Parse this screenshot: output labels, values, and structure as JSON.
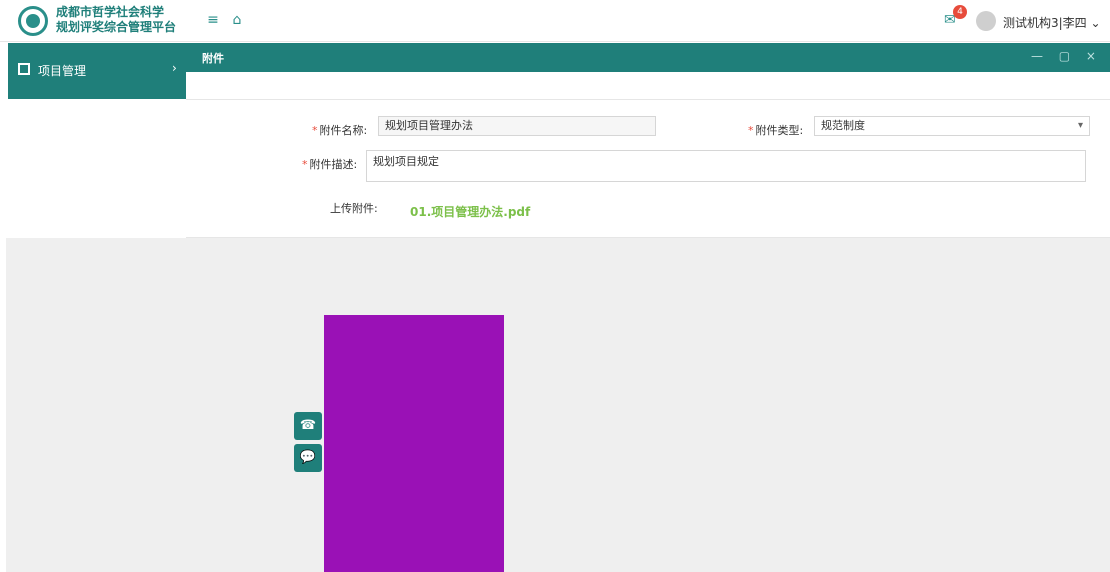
{
  "header": {
    "brand_line1": "成都市哲学社会科学",
    "brand_line2": "规划评奖综合管理平台",
    "menu_icon": "menu-icon",
    "home_icon": "home-icon",
    "message_badge": "4",
    "user_name": "测试机构3|李四"
  },
  "sidebar": {
    "items": [
      {
        "label": "项目管理",
        "icon": "square-icon",
        "arrow": "›"
      }
    ]
  },
  "panel": {
    "title": "附件",
    "tools": "— ▢ ×"
  },
  "form": {
    "name_label": "附件名称:",
    "name_value": "规划项目管理办法",
    "type_label": "附件类型:",
    "type_value": "规范制度",
    "desc_label": "附件描述:",
    "desc_value": "规划项目规定",
    "upload_label": "上传附件:",
    "file_name": "01.项目管理办法.pdf"
  },
  "floating": {
    "phone_icon": "phone-icon",
    "chat_icon": "chat-icon"
  }
}
